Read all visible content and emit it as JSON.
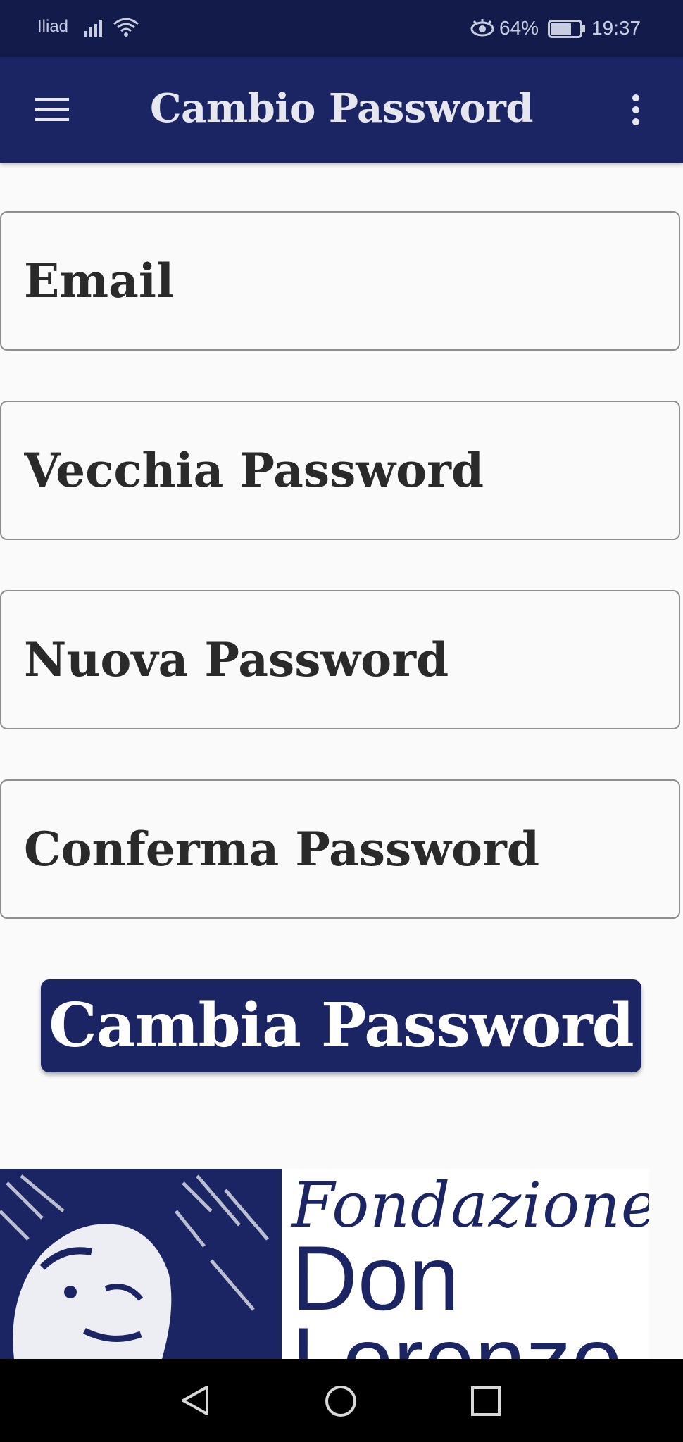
{
  "status_bar": {
    "carrier": "Iliad",
    "battery_percent": "64%",
    "time": "19:37",
    "icons": [
      "signal-icon",
      "wifi-icon",
      "eye-comfort-icon",
      "battery-icon"
    ]
  },
  "app_bar": {
    "title": "Cambio Password",
    "menu_icon": "hamburger-menu-icon",
    "overflow_icon": "more-vert-icon"
  },
  "form": {
    "email_placeholder": "Email",
    "old_password_placeholder": "Vecchia Password",
    "new_password_placeholder": "Nuova Password",
    "confirm_password_placeholder": "Conferma Password",
    "submit_label": "Cambia Password"
  },
  "logo": {
    "line1": "Fondazione",
    "line2": "Don",
    "line3": "Lorenzo"
  },
  "colors": {
    "status_bar_bg": "#131b4a",
    "app_bar_bg": "#1b2564",
    "accent": "#1b2564",
    "background": "#fafafa"
  },
  "nav_bar": {
    "icons": [
      "back-icon",
      "home-icon",
      "recents-icon"
    ]
  }
}
